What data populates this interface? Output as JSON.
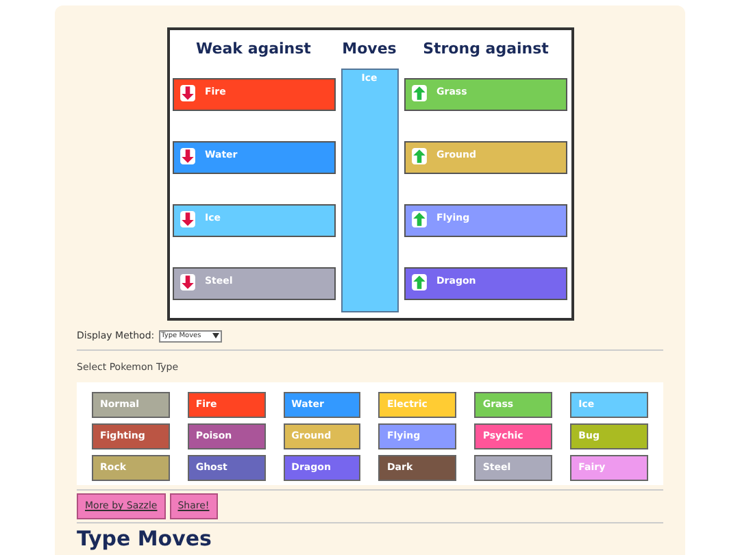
{
  "chart": {
    "weak_heading": "Weak against",
    "moves_heading": "Moves",
    "strong_heading": "Strong against",
    "weak_against": [
      {
        "label": "Fire",
        "color": "#ff4422"
      },
      {
        "label": "Water",
        "color": "#3399ff"
      },
      {
        "label": "Ice",
        "color": "#66ccff"
      },
      {
        "label": "Steel",
        "color": "#aaaabb"
      }
    ],
    "move": {
      "label": "Ice",
      "color": "#66ccff"
    },
    "strong_against": [
      {
        "label": "Grass",
        "color": "#77cc55"
      },
      {
        "label": "Ground",
        "color": "#ddbb55"
      },
      {
        "label": "Flying",
        "color": "#8899ff"
      },
      {
        "label": "Dragon",
        "color": "#7766ee"
      }
    ]
  },
  "display_method": {
    "label": "Display Method:",
    "value": "Type Moves"
  },
  "type_picker": {
    "label": "Select Pokemon Type",
    "types": [
      {
        "label": "Normal",
        "color": "#aaaa99"
      },
      {
        "label": "Fire",
        "color": "#ff4422"
      },
      {
        "label": "Water",
        "color": "#3399ff"
      },
      {
        "label": "Electric",
        "color": "#ffcc33"
      },
      {
        "label": "Grass",
        "color": "#77cc55"
      },
      {
        "label": "Ice",
        "color": "#66ccff"
      },
      {
        "label": "Fighting",
        "color": "#bb5544"
      },
      {
        "label": "Poison",
        "color": "#aa5599"
      },
      {
        "label": "Ground",
        "color": "#ddbb55"
      },
      {
        "label": "Flying",
        "color": "#8899ff"
      },
      {
        "label": "Psychic",
        "color": "#ff5599"
      },
      {
        "label": "Bug",
        "color": "#aabb22"
      },
      {
        "label": "Rock",
        "color": "#bbaa66"
      },
      {
        "label": "Ghost",
        "color": "#6666bb"
      },
      {
        "label": "Dragon",
        "color": "#7766ee"
      },
      {
        "label": "Dark",
        "color": "#775544"
      },
      {
        "label": "Steel",
        "color": "#aaaabb"
      },
      {
        "label": "Fairy",
        "color": "#ee99ee"
      }
    ]
  },
  "links": [
    "More by Sazzle",
    "Share!"
  ],
  "section_heading": "Type Moves"
}
